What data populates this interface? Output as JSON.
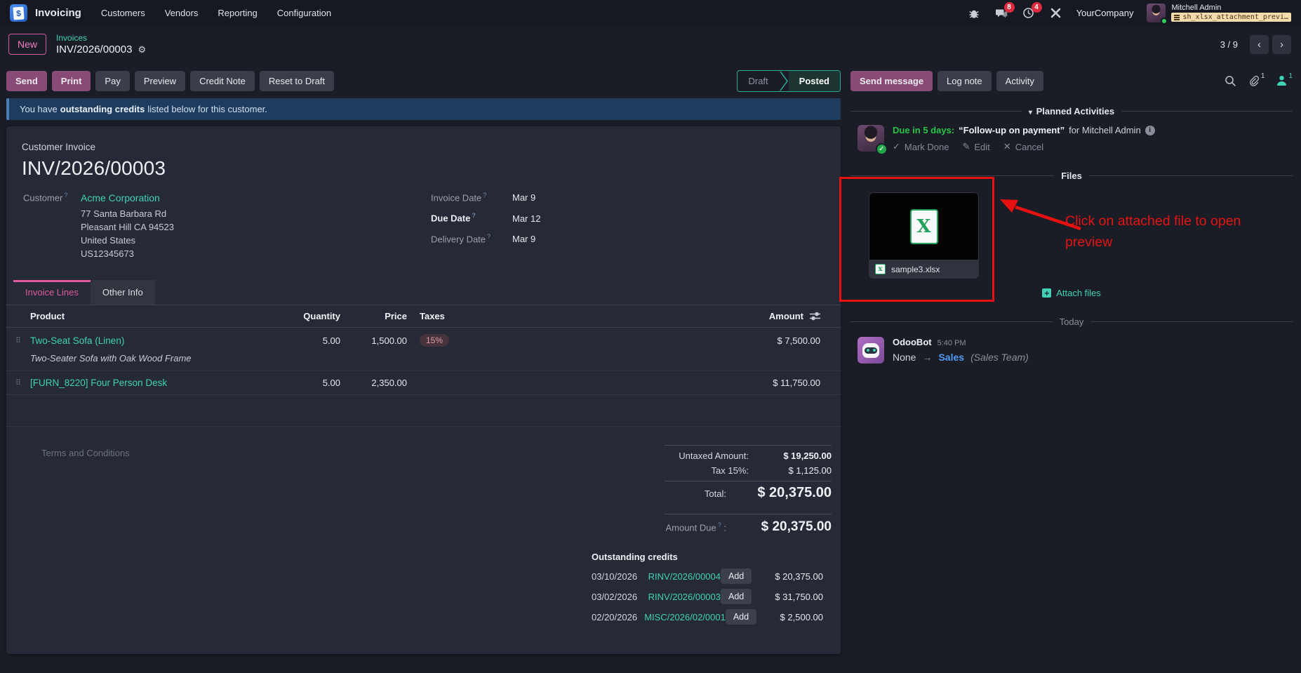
{
  "icons": {
    "gear": "⚙",
    "caret_down": "▾",
    "check": "✓",
    "pencil": "✎",
    "cross": "✕",
    "chevron_left": "‹",
    "chevron_right": "›",
    "info": "i",
    "arrow_right": "→",
    "plus": "+",
    "dollar": "$",
    "drag_handle": "⠿",
    "excel_letter": "X",
    "excel_letter_small": "x"
  },
  "nav": {
    "app_name": "Invoicing",
    "menus": [
      "Customers",
      "Vendors",
      "Reporting",
      "Configuration"
    ],
    "badges": {
      "messages": "8",
      "activities": "4"
    },
    "company": "YourCompany",
    "user_name": "Mitchell Admin",
    "debug_badge": "sh_xlsx_attachment_previ…"
  },
  "breadcrumb": {
    "new_label": "New",
    "parent": "Invoices",
    "current": "INV/2026/00003",
    "pager": "3 / 9"
  },
  "statusbar": {
    "buttons": [
      "Send",
      "Print",
      "Pay",
      "Preview",
      "Credit Note",
      "Reset to Draft"
    ],
    "states": [
      "Draft",
      "Posted"
    ]
  },
  "alert": {
    "prefix": "You have",
    "bold": "outstanding credits",
    "suffix": "listed below for this customer."
  },
  "invoice": {
    "type_label": "Customer Invoice",
    "name": "INV/2026/00003",
    "customer_label": "Customer",
    "customer_name": "Acme Corporation",
    "address_lines": [
      "77 Santa Barbara Rd",
      "Pleasant Hill CA 94523",
      "United States",
      "US12345673"
    ],
    "fields": [
      {
        "label": "Invoice Date",
        "value": "Mar 9"
      },
      {
        "label": "Due Date",
        "value": "Mar 12"
      },
      {
        "label": "Delivery Date",
        "value": "Mar 9"
      }
    ],
    "tabs": [
      "Invoice Lines",
      "Other Info"
    ],
    "table": {
      "headers": [
        "Product",
        "Quantity",
        "Price",
        "Taxes",
        "Amount"
      ],
      "rows": [
        {
          "product": "Two-Seat Sofa (Linen)",
          "description": "Two-Seater Sofa with Oak Wood Frame",
          "quantity": "5.00",
          "price": "1,500.00",
          "tax": "15%",
          "amount": "$ 7,500.00"
        },
        {
          "product": "[FURN_8220] Four Person Desk",
          "quantity": "5.00",
          "price": "2,350.00",
          "amount": "$ 11,750.00"
        }
      ]
    },
    "terms_placeholder": "Terms and Conditions",
    "totals": {
      "untaxed_label": "Untaxed Amount:",
      "untaxed_value": "$ 19,250.00",
      "tax_label": "Tax 15%:",
      "tax_value": "$ 1,125.00",
      "total_label": "Total:",
      "total_value": "$ 20,375.00",
      "amount_due_label": "Amount Due",
      "amount_due_colon": ":",
      "amount_due_value": "$ 20,375.00"
    },
    "outstanding": {
      "title": "Outstanding credits",
      "add_label": "Add",
      "rows": [
        {
          "date": "03/10/2026",
          "ref": "RINV/2026/00004",
          "amount": "$ 20,375.00"
        },
        {
          "date": "03/02/2026",
          "ref": "RINV/2026/00003",
          "amount": "$ 31,750.00"
        },
        {
          "date": "02/20/2026",
          "ref": "MISC/2026/02/0001",
          "amount": "$ 2,500.00"
        }
      ]
    }
  },
  "chatter": {
    "buttons": [
      "Send message",
      "Log note",
      "Activity"
    ],
    "attachment_count": "1",
    "follower_count": "1",
    "activities_title": "Planned Activities",
    "activity": {
      "due": "Due in 5 days:",
      "summary": "“Follow-up on payment”",
      "assignee": "for Mitchell Admin",
      "mark_done": "Mark Done",
      "edit": "Edit",
      "cancel": "Cancel"
    },
    "files_title": "Files",
    "attachment_name": "sample3.xlsx",
    "attach_files_label": "Attach files",
    "today_label": "Today",
    "message": {
      "author": "OdooBot",
      "time": "5:40 PM",
      "from": "None",
      "to": "Sales",
      "team": "(Sales Team)"
    }
  },
  "annotation": {
    "line1": "Click on attached file to open",
    "line2": "preview"
  },
  "colors": {
    "teal": "#3fd2b4",
    "pink": "#e0589f",
    "purple": "#8a4a77",
    "annotation_red": "#e81111",
    "link_blue": "#519af2",
    "activity_green": "#27c648",
    "alert_bg": "#1e3c5e",
    "card_bg": "#262a36"
  }
}
